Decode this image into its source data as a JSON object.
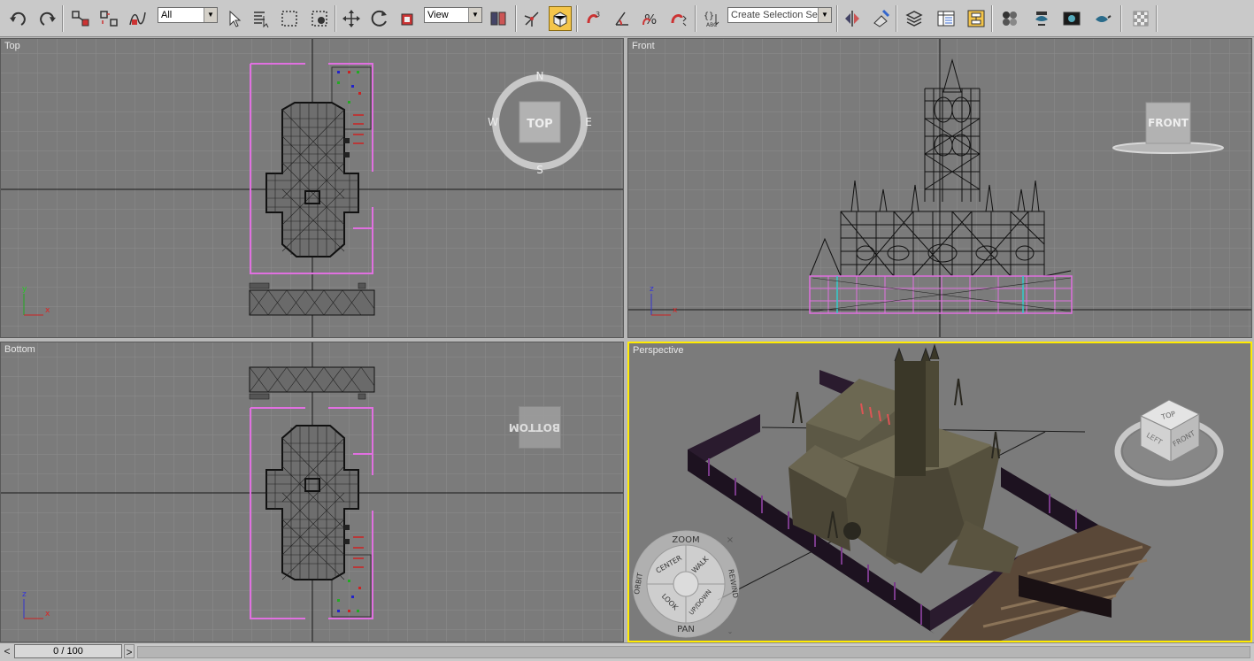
{
  "toolbar": {
    "selection_filter": "All",
    "reference_coord": "View",
    "named_selection": "Create Selection Set",
    "buttons": [
      "undo-icon",
      "redo-icon",
      "select-link-icon",
      "unlink-icon",
      "bind-spacewarp-icon",
      "select-object-icon",
      "select-by-name-icon",
      "rect-region-icon",
      "window-crossing-icon",
      "move-icon",
      "rotate-icon",
      "scale-icon",
      "pivot-icon",
      "manipulate-icon",
      "snaps-toggle-icon",
      "angle-snap-icon",
      "percent-snap-icon",
      "spinner-snap-icon",
      "named-sets-icon",
      "mirror-icon",
      "align-icon",
      "layer-manager-icon",
      "curve-editor-icon",
      "schematic-view-icon",
      "material-editor-icon",
      "render-setup-icon",
      "rendered-frame-icon",
      "render-icon",
      "extra-icon"
    ]
  },
  "viewports": {
    "top": {
      "label": "Top",
      "cube": "TOP",
      "compass": [
        "N",
        "E",
        "S",
        "W"
      ]
    },
    "front": {
      "label": "Front",
      "cube": "FRONT"
    },
    "bottom": {
      "label": "Bottom",
      "cube": "BOTTOM"
    },
    "perspective": {
      "label": "Perspective",
      "cube_faces": [
        "TOP",
        "LEFT",
        "FRONT"
      ]
    }
  },
  "steering_wheel": {
    "items": [
      "ZOOM",
      "CENTER",
      "WALK",
      "REWIND",
      "ORBIT",
      "LOOK",
      "UP/DOWN",
      "PAN"
    ]
  },
  "axes": {
    "x": "x",
    "y": "y",
    "z": "z"
  },
  "timeline": {
    "frame": "0 / 100",
    "prev": "<",
    "next": ">"
  },
  "colors": {
    "active_border": "#ffeb00",
    "viewport_bg": "#7b7b7b",
    "selection": "#e070e0"
  }
}
